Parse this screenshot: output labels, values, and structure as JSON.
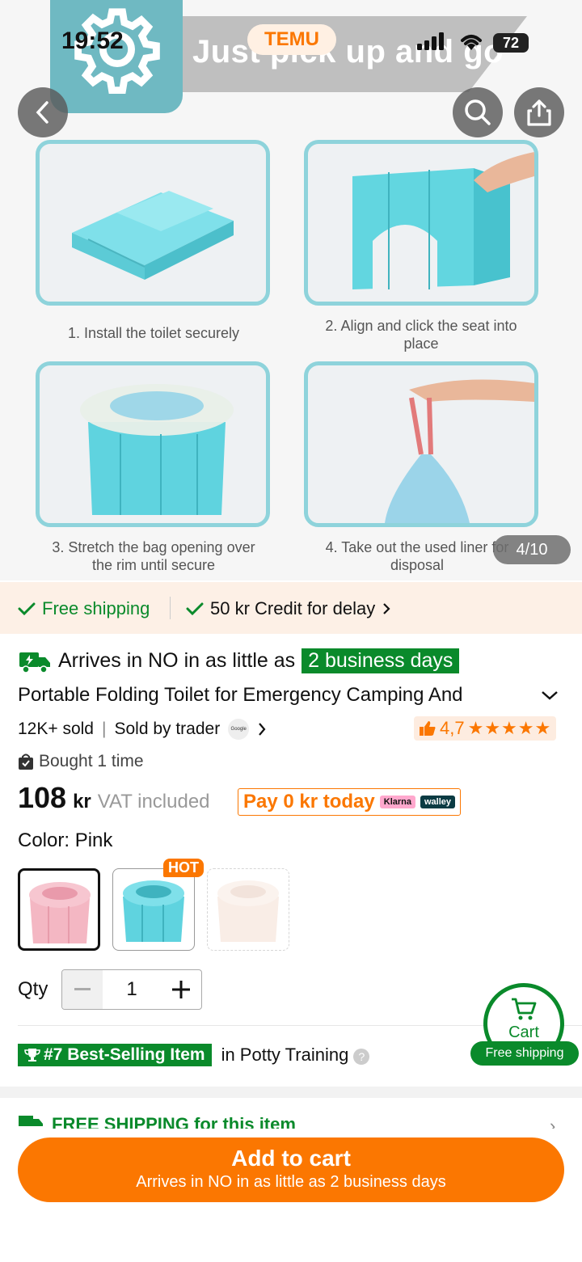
{
  "status_bar": {
    "time": "19:52",
    "battery": "72",
    "app_label": "TEMU"
  },
  "gallery": {
    "banner_text": "Just pick up and go",
    "counter": "4/10",
    "captions": [
      "1. Install the toilet securely",
      "2. Align and click the seat into place",
      "3. Stretch the bag opening over the rim until secure",
      "4. Take out the used liner for disposal"
    ]
  },
  "shipping_strip": {
    "free_shipping": "Free shipping",
    "credit": "50 kr Credit for delay"
  },
  "arrival": {
    "prefix": "Arrives in NO in as little as",
    "badge": "2 business days"
  },
  "product": {
    "title": "Portable Folding Toilet for Emergency Camping And",
    "sold": "12K+ sold",
    "sold_by": "Sold by trader",
    "store_logo_text": "Google",
    "rating": "4,7",
    "stars": "★★★★★",
    "bought": "Bought 1 time",
    "price": "108",
    "currency": "kr",
    "vat": "VAT included",
    "pay_today": "Pay 0 kr today",
    "klarna": "Klarna",
    "walley": "walley",
    "color_label": "Color: Pink",
    "hot_badge": "HOT",
    "qty_label": "Qty",
    "qty_value": "1",
    "best_badge": "#7 Best-Selling Item",
    "best_category": "in Potty Training",
    "free_shipping_item": "FREE SHIPPING for this item"
  },
  "cart_float": {
    "label": "Cart",
    "free_shipping": "Free shipping"
  },
  "bottom": {
    "add_to_cart": "Add to cart",
    "subtitle": "Arrives in NO in as little as 2 business days"
  },
  "colors": {
    "accent": "#fb7701",
    "green": "#0a8a2b",
    "teal": "#8ed3db",
    "pink_swatch": "#f4b7c3",
    "cyan_swatch": "#5fd3df",
    "cream_swatch": "#f6e2d6"
  }
}
